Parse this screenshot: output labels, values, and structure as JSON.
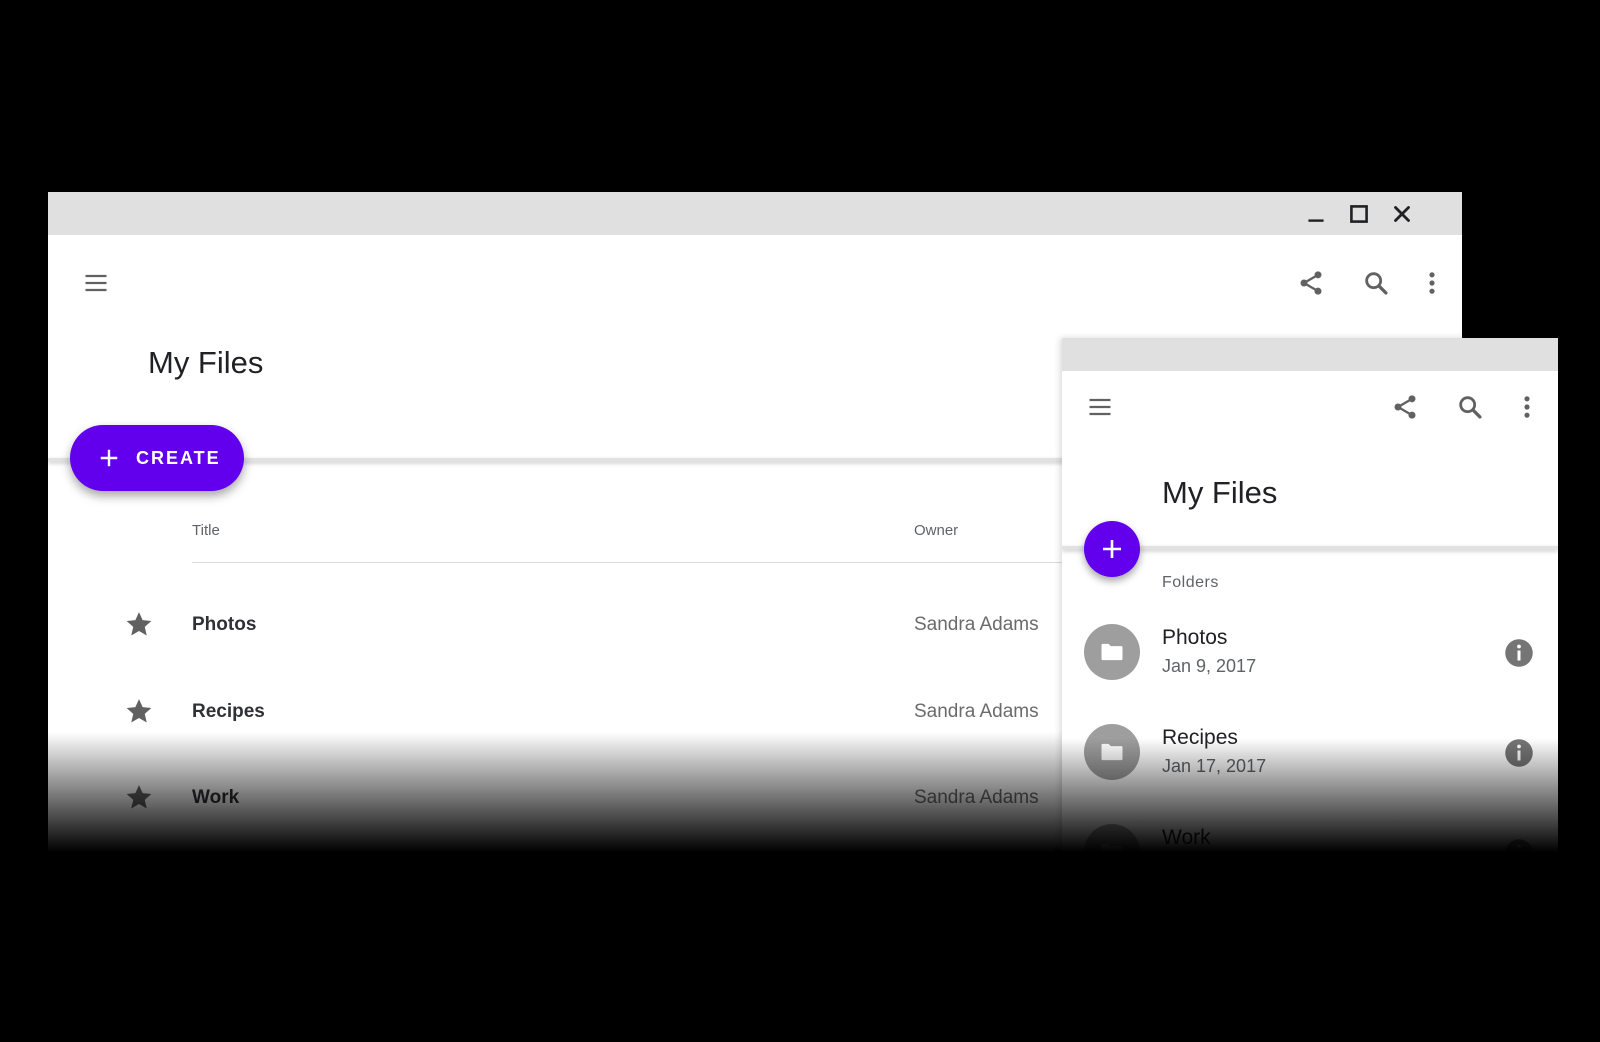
{
  "colors": {
    "accent": "#6200ee",
    "titlebar": "#e0e0e0",
    "icon": "#616161",
    "folder_avatar": "#9e9e9e"
  },
  "large_window": {
    "titlebar": {
      "controls": [
        {
          "icon": "minimize-icon"
        },
        {
          "icon": "maximize-icon"
        },
        {
          "icon": "close-icon"
        }
      ]
    },
    "appbar": {
      "menu_icon": "menu-icon",
      "actions": [
        {
          "icon": "share-icon"
        },
        {
          "icon": "search-icon"
        },
        {
          "icon": "more-vert-icon"
        }
      ],
      "title": "My Files"
    },
    "create_button": {
      "icon": "plus-icon",
      "label": "CREATE"
    },
    "table": {
      "columns": {
        "title": "Title",
        "owner": "Owner"
      },
      "rows": [
        {
          "starred": true,
          "title": "Photos",
          "owner": "Sandra Adams"
        },
        {
          "starred": true,
          "title": "Recipes",
          "owner": "Sandra Adams"
        },
        {
          "starred": true,
          "title": "Work",
          "owner": "Sandra Adams"
        }
      ]
    }
  },
  "small_window": {
    "appbar": {
      "menu_icon": "menu-icon",
      "actions": [
        {
          "icon": "share-icon"
        },
        {
          "icon": "search-icon"
        },
        {
          "icon": "more-vert-icon"
        }
      ],
      "title": "My Files"
    },
    "fab": {
      "icon": "plus-icon"
    },
    "subheader": "Folders",
    "folders": [
      {
        "icon": "folder-icon",
        "name": "Photos",
        "date": "Jan 9, 2017",
        "action_icon": "info-icon"
      },
      {
        "icon": "folder-icon",
        "name": "Recipes",
        "date": "Jan 17, 2017",
        "action_icon": "info-icon"
      },
      {
        "icon": "folder-icon",
        "name": "Work",
        "date": "",
        "action_icon": "info-icon"
      }
    ]
  }
}
